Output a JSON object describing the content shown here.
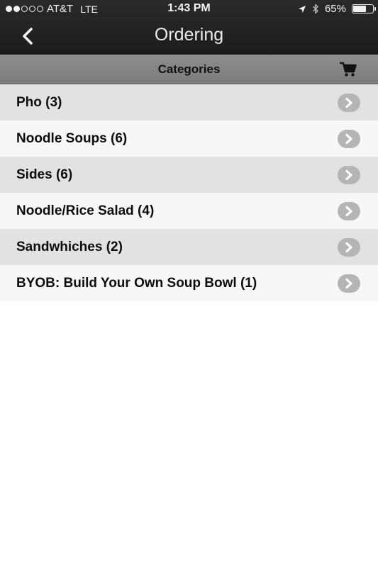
{
  "status_bar": {
    "signal_bars_filled": 2,
    "signal_bars_total": 5,
    "carrier": "AT&T",
    "network": "LTE",
    "time": "1:43 PM",
    "battery_percent": "65%",
    "battery_level": 0.65,
    "icons": [
      "location-arrow-icon",
      "bluetooth-icon",
      "battery-icon"
    ]
  },
  "nav": {
    "title": "Ordering",
    "back_icon": "chevron-left-icon"
  },
  "categories_header": {
    "title": "Categories",
    "cart_icon": "cart-icon"
  },
  "categories": [
    {
      "label": "Pho (3)"
    },
    {
      "label": "Noodle Soups (6)"
    },
    {
      "label": "Sides (6)"
    },
    {
      "label": "Noodle/Rice Salad (4)"
    },
    {
      "label": "Sandwhiches (2)"
    },
    {
      "label": "BYOB: Build Your Own Soup Bowl (1)"
    }
  ],
  "colors": {
    "topbar": "#1f1f1f",
    "header_bar": "#858585",
    "row_odd": "#e2e2e2",
    "row_even": "#f7f7f7",
    "chevron_circle": "#b5b5b5"
  }
}
